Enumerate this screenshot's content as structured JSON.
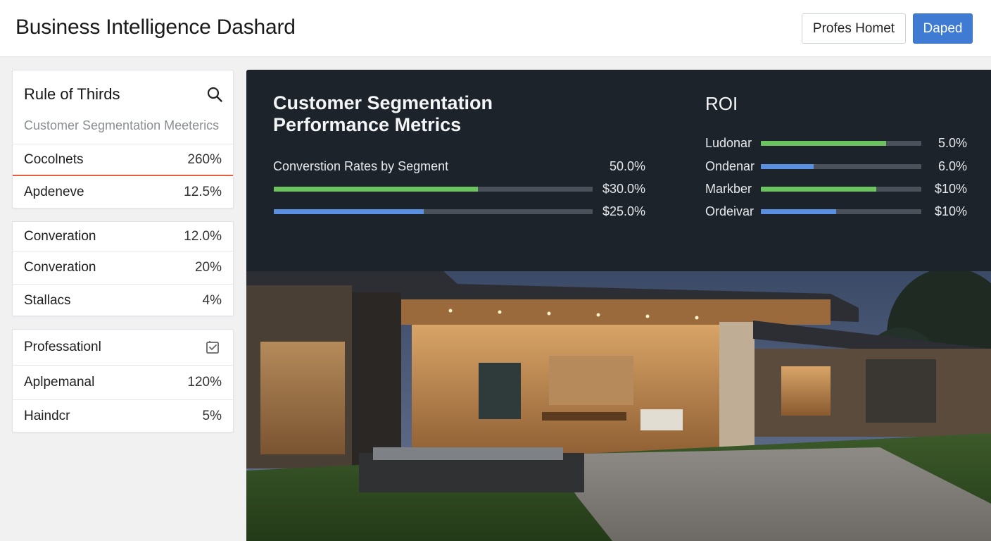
{
  "header": {
    "title": "Business Intelligence Dashard",
    "secondary_button": "Profes Homet",
    "primary_button": "Daped"
  },
  "sidebar": {
    "card1": {
      "title": "Rule of Thirds",
      "subtitle": "Customer Segmentation Meeterics",
      "rows": [
        {
          "label": "Cocolnets",
          "value": "260%"
        },
        {
          "label": "Apdeneve",
          "value": "12.5%"
        }
      ]
    },
    "card2": {
      "rows": [
        {
          "label": "Converation",
          "value": "12.0%"
        },
        {
          "label": "Converation",
          "value": "20%"
        },
        {
          "label": "Stallacs",
          "value": "4%"
        }
      ]
    },
    "card3": {
      "title": "Professationl",
      "icon": "checklist-icon",
      "rows": [
        {
          "label": "Aplpemanal",
          "value": "120%"
        },
        {
          "label": "Haindcr",
          "value": "5%"
        }
      ]
    }
  },
  "main": {
    "metrics_title_line1": "Customer Segmentation",
    "metrics_title_line2": "Performance Metrics",
    "segment_label": "Converstion Rates by Segment",
    "segment_header_value": "50.0%",
    "segment_bars": [
      {
        "value_label": "$30.0%",
        "fill": 0.64,
        "color": "#6cc35f"
      },
      {
        "value_label": "$25.0%",
        "fill": 0.47,
        "color": "#5b8fe0"
      }
    ],
    "roi": {
      "title": "ROI",
      "rows": [
        {
          "label": "Ludonar",
          "value": "5.0%",
          "fill": 0.78,
          "color": "#6cc35f"
        },
        {
          "label": "Ondenar",
          "value": "6.0%",
          "fill": 0.33,
          "color": "#5b8fe0"
        },
        {
          "label": "Markber",
          "value": "$10%",
          "fill": 0.72,
          "color": "#6cc35f"
        },
        {
          "label": "Ordeivar",
          "value": "$10%",
          "fill": 0.47,
          "color": "#5b8fe0"
        }
      ]
    }
  },
  "colors": {
    "accent_red": "#e4603f",
    "primary_blue": "#3f7bd3",
    "panel_dark": "#1d232b",
    "bar_green": "#6cc35f",
    "bar_blue": "#5b8fe0"
  }
}
